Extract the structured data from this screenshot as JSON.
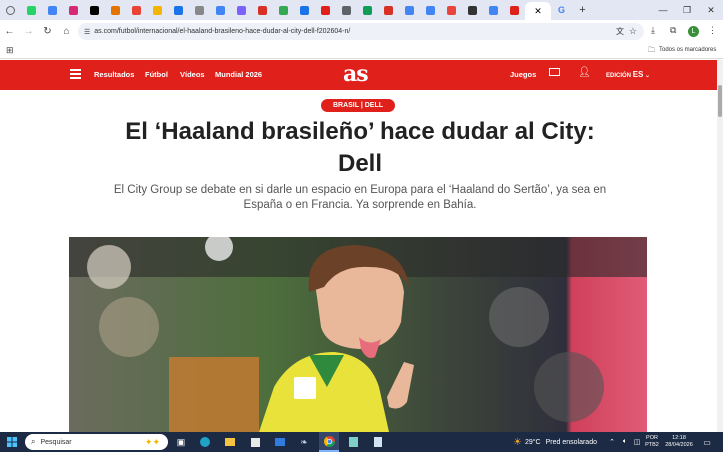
{
  "browser": {
    "tabs": [
      {
        "icon": "chrome-dropdown-icon",
        "color": "#5f6368"
      },
      {
        "icon": "whatsapp-icon",
        "color": "#25d366"
      },
      {
        "icon": "google-docs-icon",
        "color": "#4285f4"
      },
      {
        "icon": "instagram-icon",
        "color": "#d62976"
      },
      {
        "icon": "x-icon",
        "color": "#000000"
      },
      {
        "icon": "tab-icon-5",
        "color": "#e37400"
      },
      {
        "icon": "tab-icon-6",
        "color": "#ea4335"
      },
      {
        "icon": "tab-icon-7",
        "color": "#f4b400"
      },
      {
        "icon": "tab-icon-8",
        "color": "#1a73e8"
      },
      {
        "icon": "tab-icon-9",
        "color": "#888888"
      },
      {
        "icon": "tab-icon-10",
        "color": "#4285f4"
      },
      {
        "icon": "tab-icon-11",
        "color": "#7b61ff"
      },
      {
        "icon": "tab-icon-12",
        "color": "#d93025"
      },
      {
        "icon": "tab-icon-13",
        "color": "#34a853"
      },
      {
        "icon": "tab-icon-14",
        "color": "#1a73e8"
      },
      {
        "icon": "tab-icon-15",
        "color": "#e0201a"
      },
      {
        "icon": "tab-icon-16",
        "color": "#5f6368"
      },
      {
        "icon": "tab-icon-17",
        "color": "#0f9d58"
      },
      {
        "icon": "tab-icon-18",
        "color": "#d93025"
      },
      {
        "icon": "tab-icon-19",
        "color": "#4285f4"
      },
      {
        "icon": "google-icon",
        "color": "#4285f4"
      },
      {
        "icon": "tab-icon-21",
        "color": "#e8453c"
      },
      {
        "icon": "tab-icon-22",
        "color": "#333333"
      },
      {
        "icon": "google-docs-icon",
        "color": "#4285f4"
      },
      {
        "icon": "tab-icon-24",
        "color": "#e0201a"
      }
    ],
    "active_tab_close": "✕",
    "new_tab": "G",
    "plus": "+",
    "url": "as.com/futbol/internacional/el-haaland-brasileno-hace-dudar-al-city-dell-f202604-n/",
    "bookmarks_label": "Todos os marcadores",
    "profile_initial": "L"
  },
  "site": {
    "menu": [
      "Resultados",
      "Fútbol",
      "Vídeos",
      "Mundial 2026"
    ],
    "logo": "as",
    "juegos": "Juegos",
    "edition_label": "EDICIÓN",
    "edition_value": "ES",
    "brand_color": "#e0201a"
  },
  "article": {
    "section_badge": "BRASIL | DELL",
    "headline_line1": "El ‘Haaland brasileño’ hace dudar al City:",
    "headline_line2": "Dell",
    "subheadline_line1": "El City Group se debate en si darle un espacio en Europa para el ‘Haaland do Sertão’, ya sea en",
    "subheadline_line2": "España o en Francia. Ya sorprende en Bahía."
  },
  "taskbar": {
    "search_placeholder": "Pesquisar",
    "weather_temp": "29°C",
    "weather_text": "Pred ensolarado",
    "lang_line1": "POR",
    "lang_line2": "PTB2",
    "time": "12:18",
    "date": "28/04/2026"
  }
}
